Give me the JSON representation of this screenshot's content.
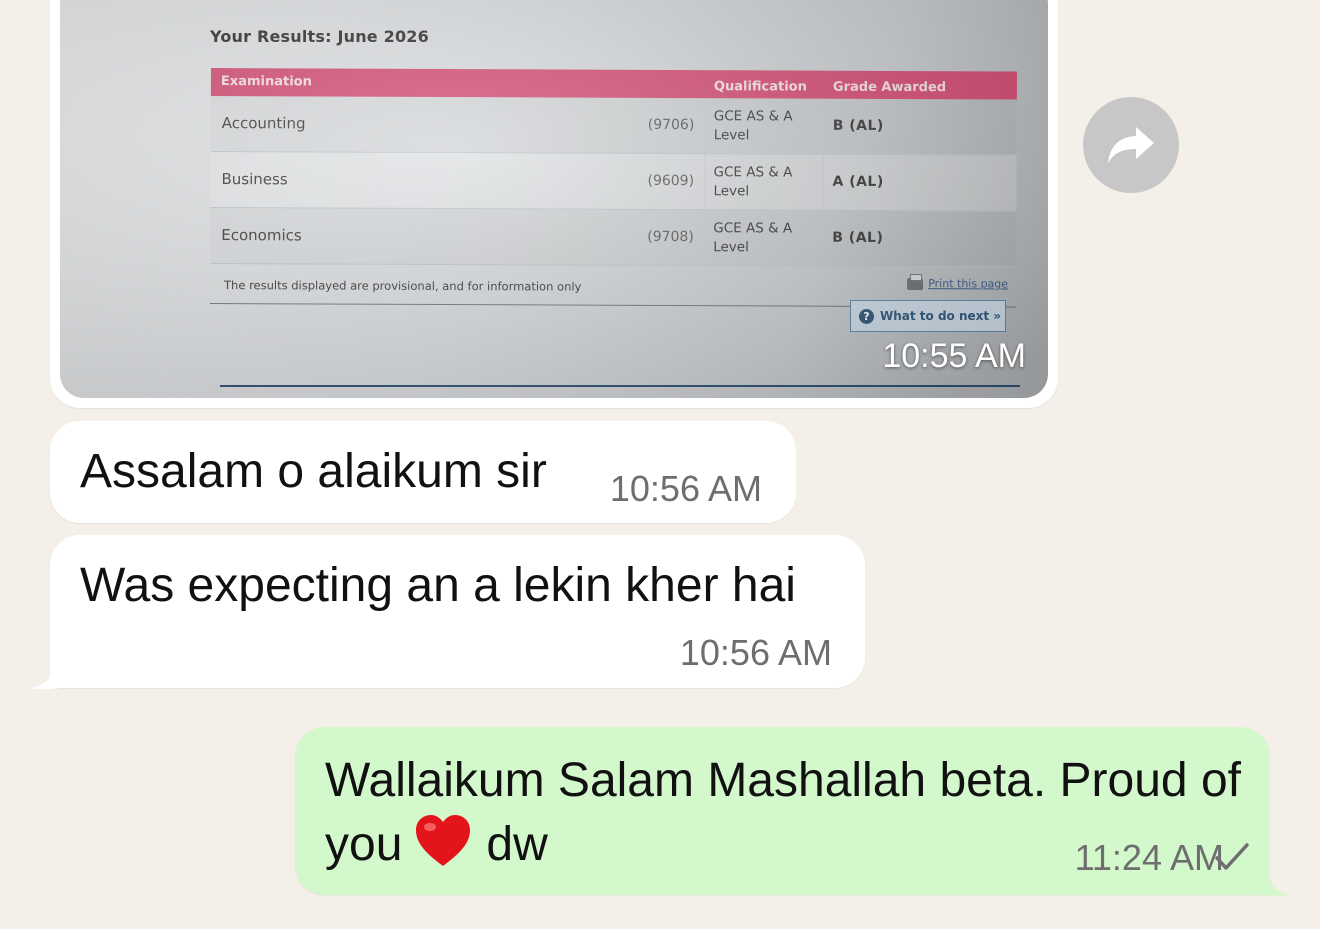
{
  "photo": {
    "results_title": "Your Results: June 2026",
    "columns": {
      "examination": "Examination",
      "qualification": "Qualification",
      "grade": "Grade Awarded"
    },
    "rows": [
      {
        "subject": "Accounting",
        "code": "(9706)",
        "qualification": "GCE AS & A Level",
        "grade": "B (AL)"
      },
      {
        "subject": "Business",
        "code": "(9609)",
        "qualification": "GCE AS & A Level",
        "grade": "A (AL)"
      },
      {
        "subject": "Economics",
        "code": "(9708)",
        "qualification": "GCE AS & A Level",
        "grade": "B (AL)"
      }
    ],
    "note": "The results displayed are provisional, and for information only",
    "print_label": "Print this page",
    "next_label": "What to do next »",
    "header_color": "#d1476f"
  },
  "image_message": {
    "time": "10:55 AM"
  },
  "messages": [
    {
      "text": "Assalam o alaikum sir",
      "time": "10:56 AM",
      "direction": "incoming"
    },
    {
      "text": "Was expecting an a lekin kher hai",
      "time": "10:56 AM",
      "direction": "incoming"
    },
    {
      "text_before_emoji": "Wallaikum Salam Mashallah beta. Proud of you",
      "emoji": "red-heart-icon",
      "text_after_emoji": "dw",
      "time": "11:24 AM",
      "status": "sent-check-icon",
      "direction": "outgoing"
    }
  ],
  "colors": {
    "background": "#f4efe8",
    "incoming_bubble": "#ffffff",
    "outgoing_bubble": "#d3f8cc",
    "time_text": "#6e6e6e"
  }
}
